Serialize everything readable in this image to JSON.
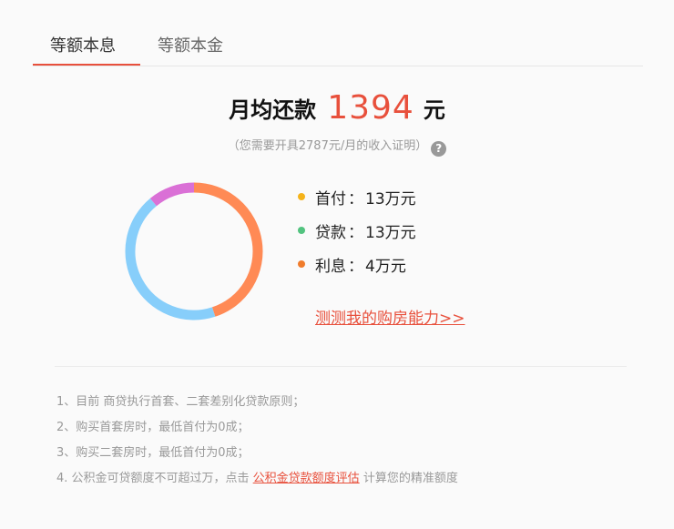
{
  "tabs": [
    {
      "label": "等额本息",
      "active": true
    },
    {
      "label": "等额本金",
      "active": false
    }
  ],
  "summary": {
    "label": "月均还款",
    "amount": "1394",
    "unit": "元",
    "note": "（您需要开具2787元/月的收入证明）",
    "help_icon": "?"
  },
  "breakdown": [
    {
      "label": "首付",
      "colon": "：",
      "value": "13万元",
      "color": "#f5b31a"
    },
    {
      "label": "贷款",
      "colon": "：",
      "value": "13万元",
      "color": "#52c37f"
    },
    {
      "label": "利息",
      "colon": "：",
      "value": "4万元",
      "color": "#f07c2c"
    }
  ],
  "chart_data": {
    "type": "pie",
    "title": "",
    "segments": [
      {
        "value": 45,
        "color": "#ff8a55"
      },
      {
        "value": 44,
        "color": "#87cefa"
      },
      {
        "value": 11,
        "color": "#da70d6"
      }
    ]
  },
  "ability_link": "测测我的购房能力>>",
  "rules": [
    {
      "text": "1、目前 商贷执行首套、二套差别化贷款原则；"
    },
    {
      "text": "2、购买首套房时，最低首付为0成；"
    },
    {
      "text": "3、购买二套房时，最低首付为0成；"
    },
    {
      "prefix": "4. 公积金可贷额度不可超过万，点击 ",
      "link": "公积金贷款额度评估",
      "suffix": " 计算您的精准额度"
    }
  ]
}
